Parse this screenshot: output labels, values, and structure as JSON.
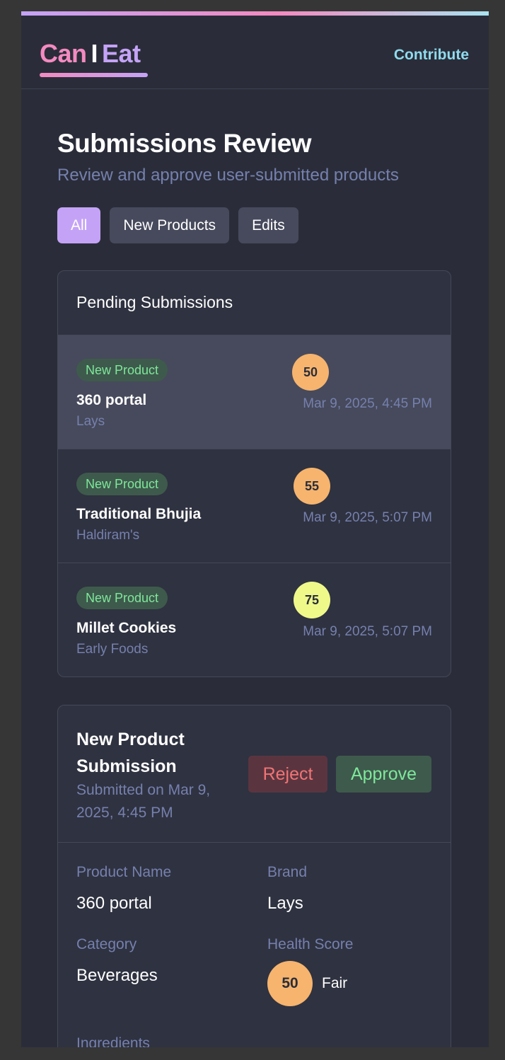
{
  "header": {
    "logo": {
      "can": "Can",
      "i": "I",
      "eat": "Eat"
    },
    "contribute_label": "Contribute"
  },
  "page": {
    "title": "Submissions Review",
    "subtitle": "Review and approve user-submitted products"
  },
  "filters": [
    {
      "label": "All",
      "active": true
    },
    {
      "label": "New Products",
      "active": false
    },
    {
      "label": "Edits",
      "active": false
    }
  ],
  "pending": {
    "title": "Pending Submissions",
    "items": [
      {
        "badge": "New Product",
        "name": "360 portal",
        "brand": "Lays",
        "score": "50",
        "date": "Mar 9, 2025, 4:45 PM",
        "selected": true
      },
      {
        "badge": "New Product",
        "name": "Traditional Bhujia",
        "brand": "Haldiram's",
        "score": "55",
        "date": "Mar 9, 2025, 5:07 PM",
        "selected": false
      },
      {
        "badge": "New Product",
        "name": "Millet Cookies",
        "brand": "Early Foods",
        "score": "75",
        "date": "Mar 9, 2025, 5:07 PM",
        "selected": false
      }
    ]
  },
  "detail": {
    "title": "New Product Submission",
    "submitted": "Submitted on Mar 9, 2025, 4:45 PM",
    "reject_label": "Reject",
    "approve_label": "Approve",
    "fields": {
      "product_name_label": "Product Name",
      "product_name": "360 portal",
      "brand_label": "Brand",
      "brand": "Lays",
      "category_label": "Category",
      "category": "Beverages",
      "health_score_label": "Health Score",
      "health_score": "50",
      "health_rating": "Fair",
      "ingredients_label": "Ingredients"
    }
  },
  "colors": {
    "background": "#2a2d39",
    "accent_purple": "#c4a3f7",
    "accent_pink": "#f38ac0",
    "link_cyan": "#8fdbee",
    "muted_text": "#7580ae",
    "badge_green_text": "#7ee89a",
    "reject_red": "#f07474",
    "score_fair": "#f6b46e",
    "score_good": "#eef98a"
  }
}
